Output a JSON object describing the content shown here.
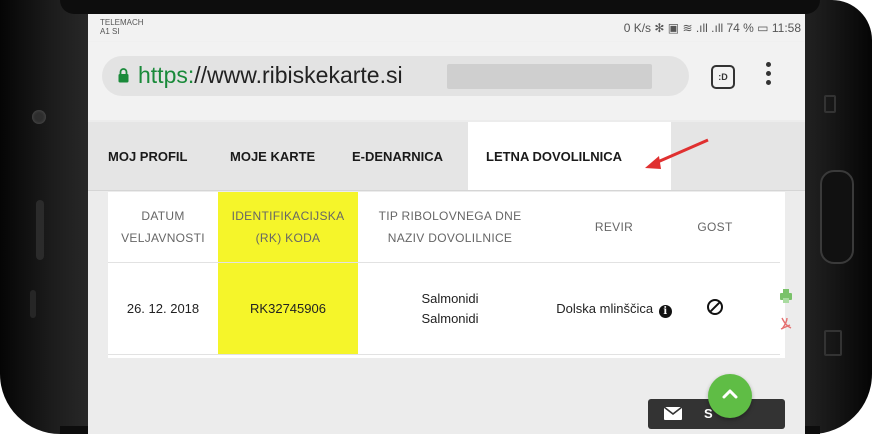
{
  "status_bar": {
    "carrier_line1": "TELEMACH",
    "carrier_line2": "A1 SI",
    "right_text": "0 K/s ✻ ▣ ≋ .ıll .ıll 74 % ▭ 11:58"
  },
  "browser": {
    "url_scheme": "https:",
    "url_rest": "//www.ribiskekarte.si",
    "amp_label": ":D"
  },
  "tabs": [
    {
      "label": "MOJ PROFIL"
    },
    {
      "label": "MOJE KARTE"
    },
    {
      "label": "E-DENARNICA"
    },
    {
      "label": "LETNA DOVOLILNICA"
    }
  ],
  "active_tab": "LETNA DOVOLILNICA",
  "table": {
    "headers": {
      "datum_1": "DATUM",
      "datum_2": "VELJAVNOSTI",
      "koda_1": "IDENTIFIKACIJSKA",
      "koda_2": "(RK) KODA",
      "tip_1": "TIP RIBOLOVNEGA DNE",
      "tip_2": "NAZIV DOVOLILNICE",
      "revir": "REVIR",
      "gost": "GOST"
    },
    "rows": [
      {
        "datum": "26. 12. 2018",
        "koda": "RK32745906",
        "tip": "Salmonidi",
        "naziv": "Salmonidi",
        "revir": "Dolska mlinščica"
      }
    ]
  },
  "bottom_button": {
    "label": "S"
  },
  "colors": {
    "highlight": "#f5f52a",
    "fab": "#5fbd45",
    "arrow": "#e03030",
    "https_green": "#1a8a3a"
  },
  "icons": [
    "lock-icon",
    "amp-icon",
    "overflow-menu-icon",
    "red-arrow-annotation",
    "info-icon",
    "prohibited-icon",
    "print-icon",
    "pdf-icon",
    "mail-icon",
    "scroll-up-icon"
  ]
}
